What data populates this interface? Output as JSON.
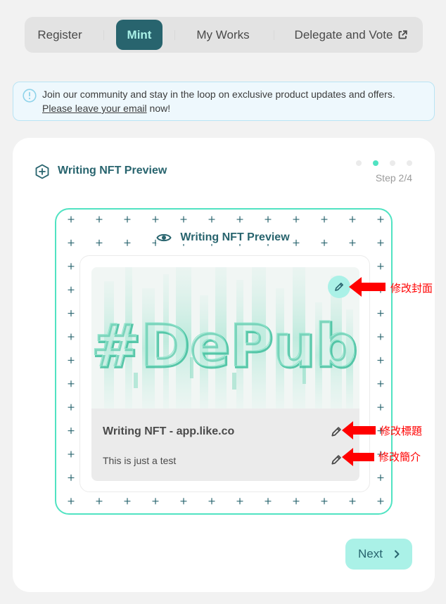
{
  "tabs": [
    {
      "label": "Register"
    },
    {
      "label": "Mint",
      "active": true
    },
    {
      "label": "My Works"
    },
    {
      "label": "Delegate and Vote",
      "external": true
    }
  ],
  "banner": {
    "text": "Join our community and stay in the loop on exclusive product updates and offers.",
    "link_label": "Please leave your email",
    "suffix": " now!"
  },
  "card": {
    "title": "Writing NFT Preview",
    "step_label": "Step 2/4",
    "steps_total": 4,
    "current_step": 2
  },
  "preview": {
    "title": "Writing NFT Preview",
    "nft_title": "Writing NFT - app.like.co",
    "nft_description": "This is just a test",
    "cover_text": "#DePub"
  },
  "annotations": {
    "edit_cover": "修改封面",
    "edit_title": "修改標題",
    "edit_description": "修改簡介"
  },
  "next_button": {
    "label": "Next"
  },
  "colors": {
    "primary": "#28646e",
    "accent": "#50e3c2",
    "light_accent": "#aaf1e7",
    "annotation": "#ff0000"
  }
}
